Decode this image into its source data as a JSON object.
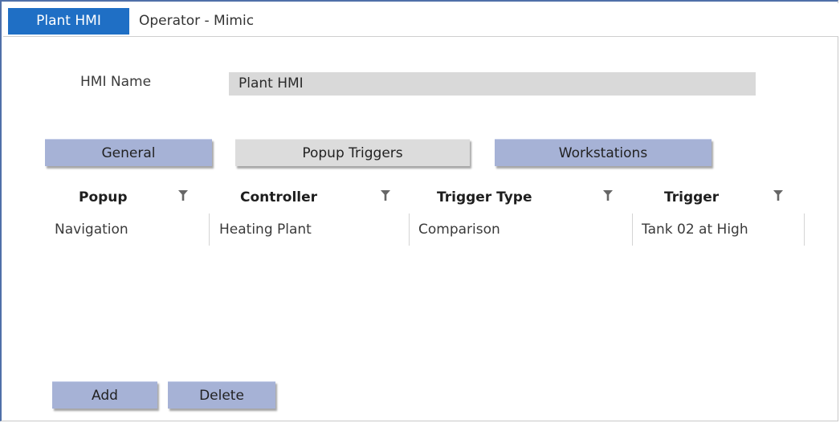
{
  "header": {
    "active_tab": "Plant HMI",
    "title": "Operator - Mimic"
  },
  "form": {
    "hmi_name_label": "HMI Name",
    "hmi_name_value": "Plant HMI"
  },
  "tabs": [
    {
      "label": "General"
    },
    {
      "label": "Popup Triggers"
    },
    {
      "label": "Workstations"
    }
  ],
  "grid": {
    "columns": [
      "Popup",
      "Controller",
      "Trigger Type",
      "Trigger"
    ],
    "rows": [
      [
        "Navigation",
        "Heating Plant",
        "Comparison",
        "Tank 02 at High"
      ]
    ]
  },
  "actions": {
    "add_label": "Add",
    "delete_label": "Delete"
  },
  "icons": {
    "filter": "filter-funnel-icon"
  },
  "colors": {
    "active_tab_bg": "#1f6fc5",
    "button_blue": "#a6b2d6",
    "button_selected": "#dcdcdc",
    "input_bg": "#d9d9d9"
  }
}
